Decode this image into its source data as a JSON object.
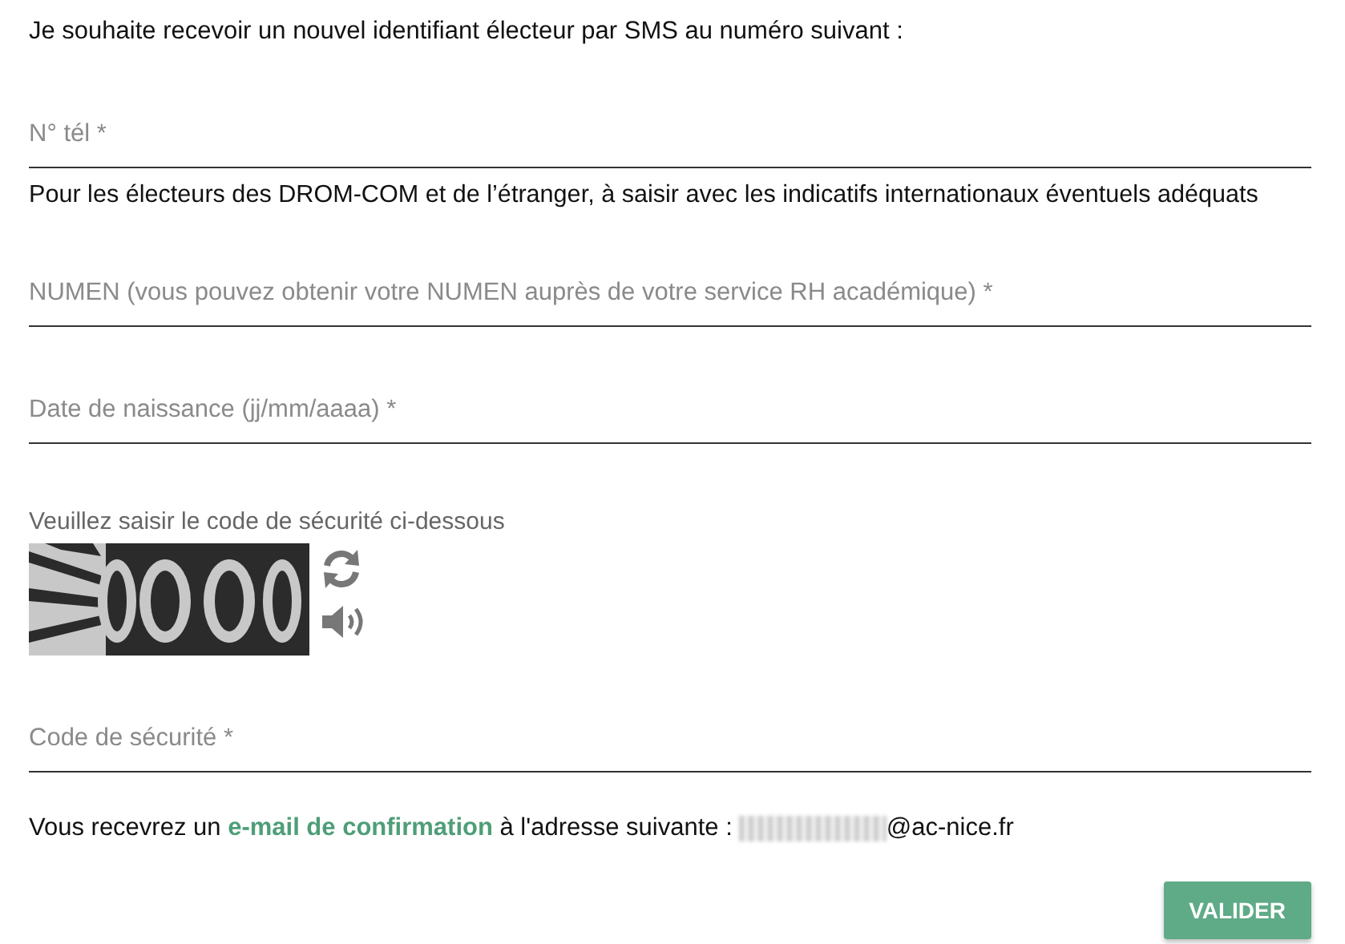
{
  "intro": "Je souhaite recevoir un nouvel identifiant électeur par SMS au numéro suivant :",
  "fields": [
    {
      "kind": "input",
      "placeholder": "N° tél *",
      "helper": "Pour les électeurs des DROM-COM et de l’étranger, à saisir avec les indicatifs internationaux éventuels adéquats"
    },
    {
      "kind": "input",
      "placeholder": "NUMEN (vous pouvez obtenir votre NUMEN auprès de votre service RH académique) *"
    },
    {
      "kind": "input",
      "placeholder": "Date de naissance (jj/mm/aaaa) *"
    },
    {
      "kind": "captcha",
      "label": "Veuillez saisir le code de sécurité ci-dessous"
    },
    {
      "kind": "input",
      "placeholder": "Code de sécurité *"
    }
  ],
  "confirmation": {
    "before": "Vous recevrez un",
    "link": "e-mail de confirmation",
    "after": "à l'adresse suivante :",
    "email_domain": "@ac-nice.fr"
  },
  "button": "VALIDER"
}
